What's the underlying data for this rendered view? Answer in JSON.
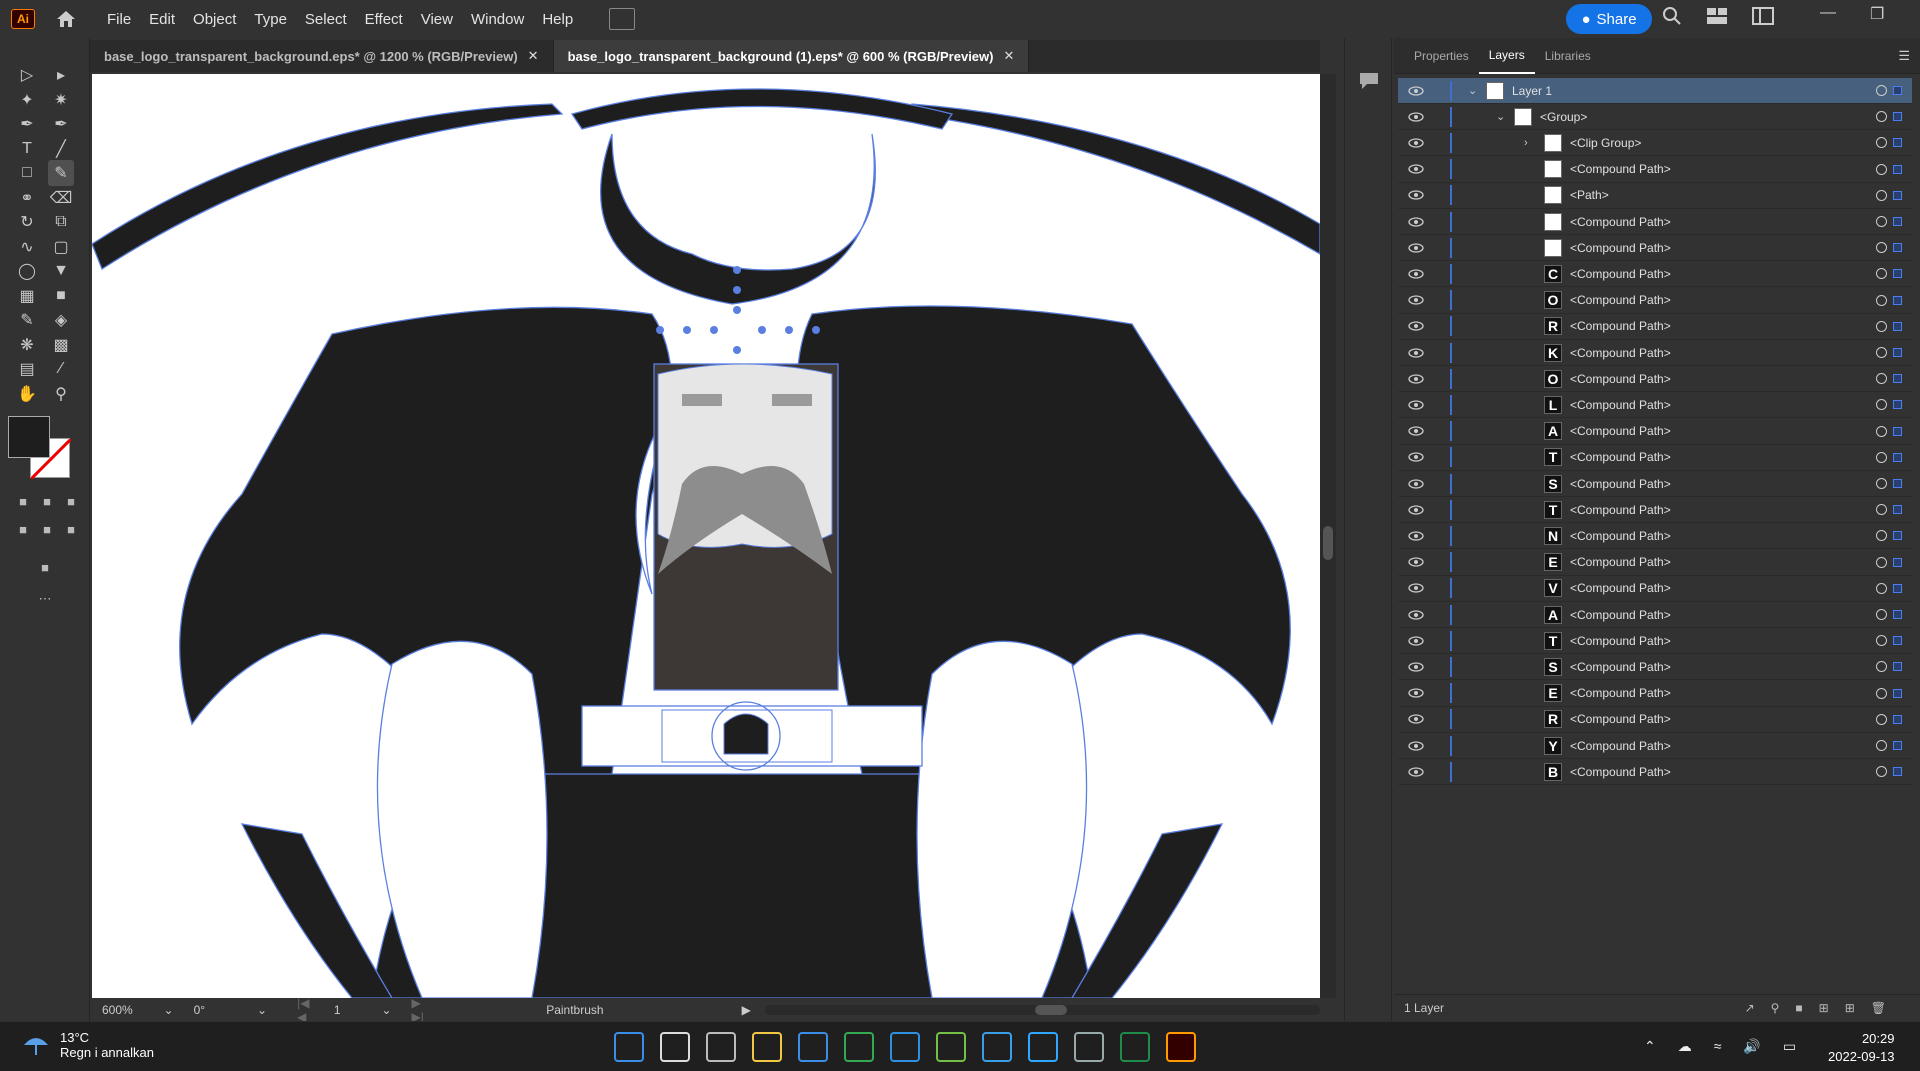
{
  "app": {
    "logo_text": "Ai"
  },
  "menu": {
    "items": [
      "File",
      "Edit",
      "Object",
      "Type",
      "Select",
      "Effect",
      "View",
      "Window",
      "Help"
    ]
  },
  "share_label": "Share",
  "tabs": [
    {
      "label": "base_logo_transparent_background.eps* @ 1200 % (RGB/Preview)",
      "active": false
    },
    {
      "label": "base_logo_transparent_background (1).eps* @ 600 % (RGB/Preview)",
      "active": true
    }
  ],
  "status": {
    "zoom": "600%",
    "rotation": "0°",
    "artboard": "1",
    "tool": "Paintbrush"
  },
  "panel": {
    "tabs": [
      "Properties",
      "Layers",
      "Libraries"
    ],
    "active_tab": "Layers",
    "layers": [
      {
        "name": "Layer 1",
        "level": 0,
        "expanded": true,
        "selected": true
      },
      {
        "name": "<Group>",
        "level": 1,
        "expanded": true
      },
      {
        "name": "<Clip Group>",
        "level": 2,
        "collapsed": true,
        "glyph": ""
      },
      {
        "name": "<Compound Path>",
        "level": 2,
        "glyph": ""
      },
      {
        "name": "<Path>",
        "level": 2,
        "glyph": ""
      },
      {
        "name": "<Compound Path>",
        "level": 2,
        "glyph": ""
      },
      {
        "name": "<Compound Path>",
        "level": 2,
        "glyph": ""
      },
      {
        "name": "<Compound Path>",
        "level": 2,
        "glyph": "C"
      },
      {
        "name": "<Compound Path>",
        "level": 2,
        "glyph": "O"
      },
      {
        "name": "<Compound Path>",
        "level": 2,
        "glyph": "R"
      },
      {
        "name": "<Compound Path>",
        "level": 2,
        "glyph": "K"
      },
      {
        "name": "<Compound Path>",
        "level": 2,
        "glyph": "O"
      },
      {
        "name": "<Compound Path>",
        "level": 2,
        "glyph": "L"
      },
      {
        "name": "<Compound Path>",
        "level": 2,
        "glyph": "A"
      },
      {
        "name": "<Compound Path>",
        "level": 2,
        "glyph": "T"
      },
      {
        "name": "<Compound Path>",
        "level": 2,
        "glyph": "S"
      },
      {
        "name": "<Compound Path>",
        "level": 2,
        "glyph": "T"
      },
      {
        "name": "<Compound Path>",
        "level": 2,
        "glyph": "N"
      },
      {
        "name": "<Compound Path>",
        "level": 2,
        "glyph": "E"
      },
      {
        "name": "<Compound Path>",
        "level": 2,
        "glyph": "V"
      },
      {
        "name": "<Compound Path>",
        "level": 2,
        "glyph": "A"
      },
      {
        "name": "<Compound Path>",
        "level": 2,
        "glyph": "T"
      },
      {
        "name": "<Compound Path>",
        "level": 2,
        "glyph": "S"
      },
      {
        "name": "<Compound Path>",
        "level": 2,
        "glyph": "E"
      },
      {
        "name": "<Compound Path>",
        "level": 2,
        "glyph": "R"
      },
      {
        "name": "<Compound Path>",
        "level": 2,
        "glyph": "Y"
      },
      {
        "name": "<Compound Path>",
        "level": 2,
        "glyph": "B"
      }
    ],
    "footer": "1 Layer"
  },
  "taskbar": {
    "weather_temp": "13°C",
    "weather_desc": "Regn i annalkan",
    "time": "20:29",
    "date": "2022-09-13"
  },
  "colors": {
    "accent": "#1473e6",
    "selection": "#4a7ff0",
    "artwork": "#1e1e1e"
  }
}
